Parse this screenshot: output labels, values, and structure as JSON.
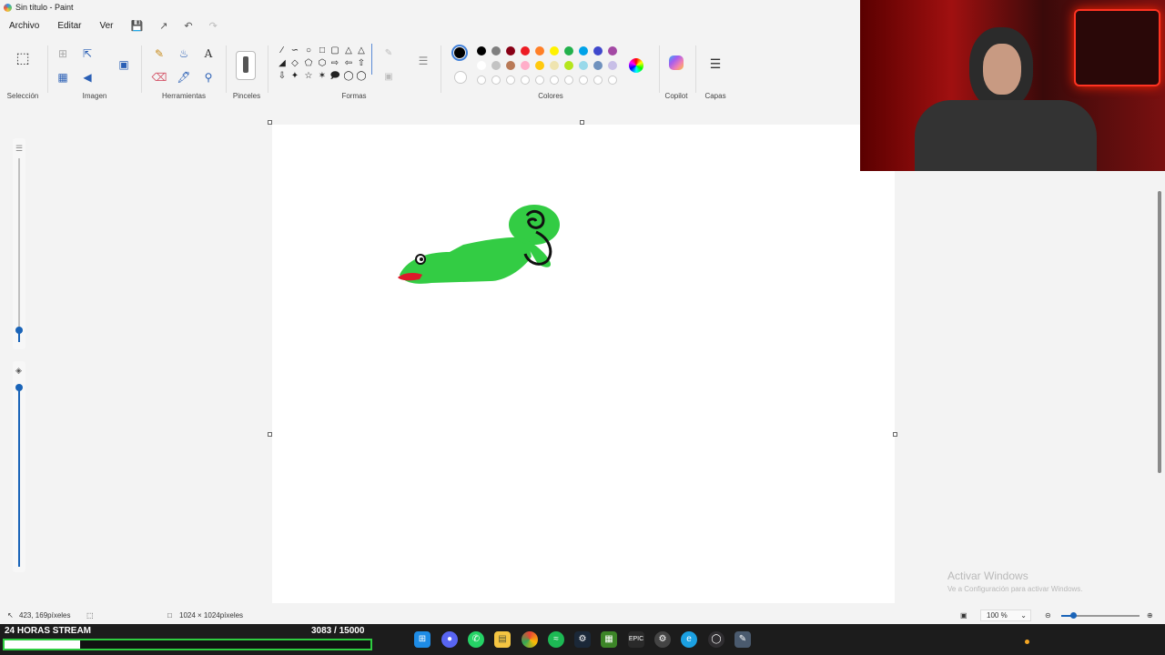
{
  "window": {
    "title": "Sin título - Paint"
  },
  "menu": {
    "items": [
      "Archivo",
      "Editar",
      "Ver"
    ]
  },
  "ribbon": {
    "groups": {
      "seleccion": "Selección",
      "imagen": "Imagen",
      "herramientas": "Herramientas",
      "pinceles": "Pinceles",
      "formas": "Formas",
      "colores": "Colores",
      "copilot": "Copilot",
      "capas": "Capas"
    },
    "text_tool_glyph": "A"
  },
  "colors": {
    "primary": "#000000",
    "palette_row1": [
      "#000000",
      "#7f7f7f",
      "#880015",
      "#ed1c24",
      "#ff7f27",
      "#fff200",
      "#22b14c",
      "#00a2e8",
      "#3f48cc",
      "#a349a4"
    ],
    "palette_row2": [
      "#ffffff",
      "#c3c3c3",
      "#b97a57",
      "#ffaec9",
      "#ffc90e",
      "#efe4b0",
      "#b5e61d",
      "#99d9ea",
      "#7092be",
      "#c8bfe7"
    ]
  },
  "status": {
    "cursor_position": "423, 169píxeles",
    "canvas_size": "1024 × 1024píxeles",
    "zoom": "100 %"
  },
  "activation": {
    "title": "Activar Windows",
    "subtitle": "Ve a Configuración para activar Windows."
  },
  "stream": {
    "title": "24 HORAS STREAM",
    "count": "3083 / 15000",
    "progress": 0.2055
  },
  "taskbar": {
    "apps": [
      "windows-start",
      "discord",
      "whatsapp",
      "file-explorer",
      "chrome",
      "spotify",
      "steam",
      "minecraft",
      "epic-games",
      "unknown",
      "edge",
      "obs",
      "paint"
    ]
  }
}
